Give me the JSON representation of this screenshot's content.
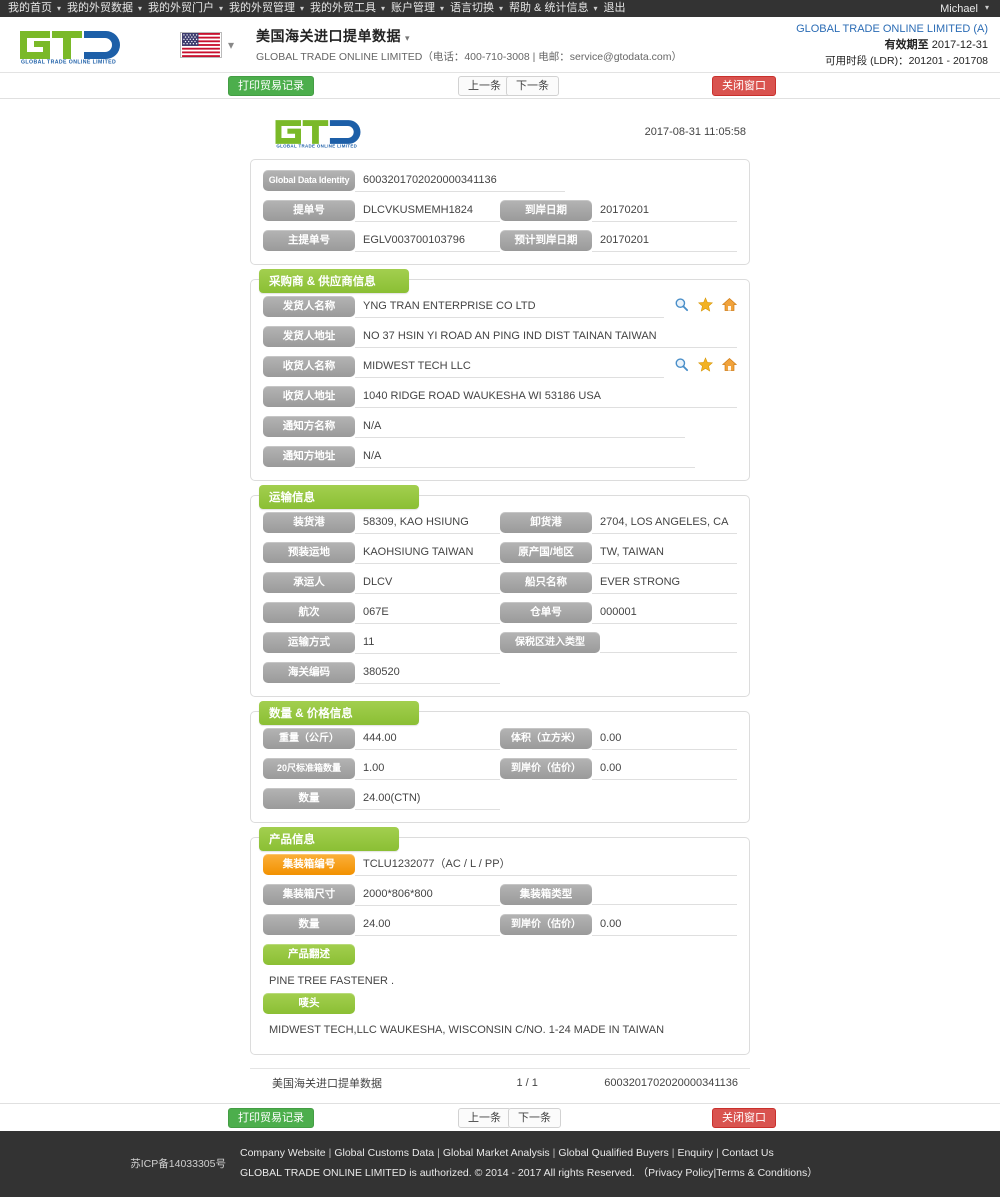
{
  "topnav": {
    "items": [
      {
        "label": "我的首页",
        "caret": true
      },
      {
        "label": "我的外贸数据",
        "caret": true
      },
      {
        "label": "我的外贸门户",
        "caret": true
      },
      {
        "label": "我的外贸管理",
        "caret": true
      },
      {
        "label": "我的外贸工具",
        "caret": true
      },
      {
        "label": "账户管理",
        "caret": true
      },
      {
        "label": "语言切换",
        "caret": true
      },
      {
        "label": "帮助 & 统计信息",
        "caret": true
      },
      {
        "label": "退出",
        "caret": false
      }
    ],
    "user": "Michael"
  },
  "header": {
    "logo_text": "GLOBAL TRADE ONLINE LIMITED",
    "flag": "us-flag-icon",
    "title": "美国海关进口提单数据",
    "subtitle": "GLOBAL TRADE ONLINE LIMITED（电话：400-710-3008 | 电邮：service@gtodata.com）",
    "account_name": "GLOBAL TRADE ONLINE LIMITED (A)",
    "expiry_label": "有效期至",
    "expiry_value": "2017-12-31",
    "ldr": "可用时段 (LDR)：201201 - 201708"
  },
  "toolbar": {
    "print_label": "打印贸易记录",
    "prev_label": "上一条",
    "next_label": "下一条",
    "close_label": "关闭窗口"
  },
  "sheet": {
    "timestamp": "2017-08-31 11:05:58",
    "identity": {
      "gdi_label": "Global Data Identity",
      "gdi_value": "6003201702020000341136",
      "rows": [
        {
          "label": "提单号",
          "value": "DLCVKUSMEMH1824",
          "label2": "到岸日期",
          "value2": "20170201"
        },
        {
          "label": "主提单号",
          "value": "EGLV003700103796",
          "label2": "预计到岸日期",
          "value2": "20170201"
        }
      ]
    },
    "parties": {
      "title": "采购商 & 供应商信息",
      "rows": [
        {
          "label": "发货人名称",
          "value": "YNG TRAN ENTERPRISE CO LTD",
          "icons": true
        },
        {
          "label": "发货人地址",
          "value": "NO 37 HSIN YI ROAD AN PING IND DIST TAINAN TAIWAN",
          "icons": false
        },
        {
          "label": "收货人名称",
          "value": "MIDWEST TECH LLC",
          "icons": true
        },
        {
          "label": "收货人地址",
          "value": "1040 RIDGE ROAD WAUKESHA WI 53186 USA",
          "icons": false
        },
        {
          "label": "通知方名称",
          "value": "N/A",
          "icons": false
        },
        {
          "label": "通知方地址",
          "value": "N/A",
          "icons": false
        }
      ]
    },
    "transport": {
      "title": "运输信息",
      "rows": [
        {
          "label": "装货港",
          "value": "58309, KAO HSIUNG",
          "label2": "卸货港",
          "value2": "2704, LOS ANGELES, CA"
        },
        {
          "label": "预装运地",
          "value": "KAOHSIUNG TAIWAN",
          "label2": "原产国/地区",
          "value2": "TW, TAIWAN"
        },
        {
          "label": "承运人",
          "value": "DLCV",
          "label2": "船只名称",
          "value2": "EVER STRONG"
        },
        {
          "label": "航次",
          "value": "067E",
          "label2": "仓单号",
          "value2": "000001"
        },
        {
          "label": "运输方式",
          "value": "11",
          "label2": "保税区进入类型",
          "value2": ""
        },
        {
          "label": "海关编码",
          "value": "380520",
          "label2": "",
          "value2": ""
        }
      ]
    },
    "quantity": {
      "title": "数量 & 价格信息",
      "rows": [
        {
          "label": "重量（公斤）",
          "value": "444.00",
          "label2": "体积（立方米）",
          "value2": "0.00"
        },
        {
          "label": "20尺标准箱数量",
          "value": "1.00",
          "label2": "到岸价（估价）",
          "value2": "0.00"
        },
        {
          "label": "数量",
          "value": "24.00(CTN)",
          "label2": "",
          "value2": ""
        }
      ]
    },
    "product": {
      "title": "产品信息",
      "container_no_label": "集装箱编号",
      "container_no_value": "TCLU1232077（AC / L / PP）",
      "rows": [
        {
          "label": "集装箱尺寸",
          "value": "2000*806*800",
          "label2": "集装箱类型",
          "value2": ""
        },
        {
          "label": "数量",
          "value": "24.00",
          "label2": "到岸价（估价）",
          "value2": "0.00"
        }
      ],
      "desc_label": "产品翻述",
      "desc_value": "PINE TREE FASTENER .",
      "mark_label": "唛头",
      "mark_value": "MIDWEST TECH,LLC WAUKESHA, WISCONSIN C/NO. 1-24 MADE IN TAIWAN"
    },
    "footer": {
      "source": "美国海关进口提单数据",
      "page": "1 / 1",
      "identity": "6003201702020000341136"
    }
  },
  "footer": {
    "icp": "苏ICP备14033305号",
    "links": [
      "Company Website",
      "Global Customs Data",
      "Global Market Analysis",
      "Global Qualified Buyers",
      "Enquiry",
      "Contact Us"
    ],
    "copy_main": "GLOBAL TRADE ONLINE LIMITED is authorized. © 2014 - 2017 All rights Reserved.",
    "copy_privacy": "Privacy Policy",
    "copy_terms": "Terms & Conditions"
  },
  "colors": {
    "green": "#8bbf34",
    "orange": "#f29100",
    "gray_label": "#9a9a9a",
    "red": "#d9534f",
    "blue_link": "#2b6cb5",
    "dark": "#333333"
  }
}
